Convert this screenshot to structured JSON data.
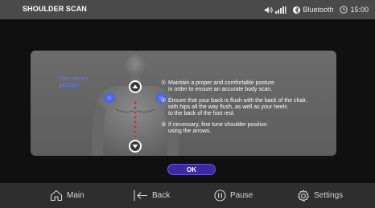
{
  "statusbar": {
    "title": "SHOULDER SCAN",
    "bluetooth_label": "Bluetooth",
    "time": "15:00",
    "icons": [
      "volume-icon",
      "signal-icon",
      "bluetooth-icon",
      "clock-icon"
    ]
  },
  "panel": {
    "correct_position_label": "The correct\nposition",
    "instructions": [
      {
        "num": "①",
        "text": "Maintain a proper and comfortable posture\n in order to ensure an accurate body scan."
      },
      {
        "num": "②",
        "text": "Ensure that your back is flush with the back of the chair,\n with hips all the way flush, as well as your heels\n to the back of the foot rest."
      },
      {
        "num": "③",
        "text": "If necessary, fine tune shoulder position\n using the arrows."
      }
    ],
    "up_arrow_icon": "chevron-up-icon",
    "down_arrow_icon": "chevron-down-icon"
  },
  "ok_button": "OK",
  "nav": {
    "main": "Main",
    "back": "Back",
    "pause": "Pause",
    "settings": "Settings"
  },
  "colors": {
    "accent_blue": "#3d2a9e",
    "label_blue": "#5a7cff",
    "marker_blue": "#4b63e8",
    "spine_red": "#d22a2a"
  }
}
